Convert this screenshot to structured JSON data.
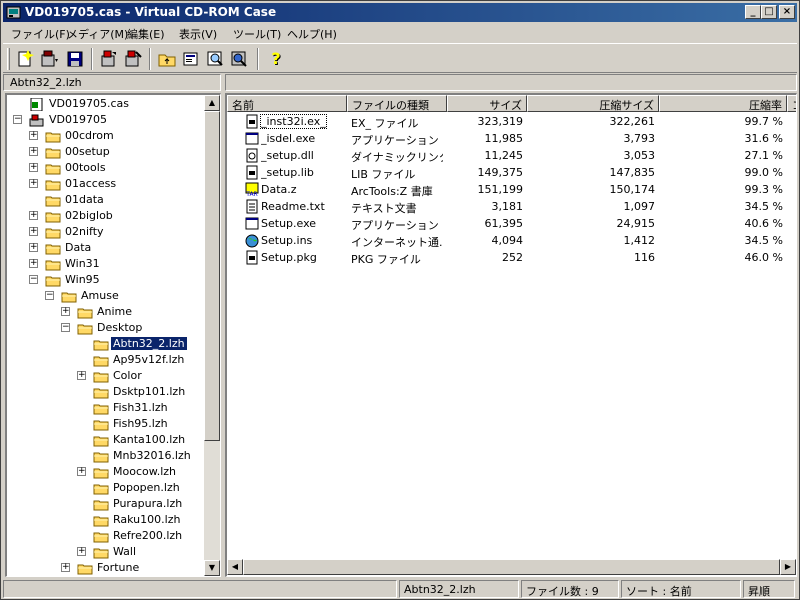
{
  "window": {
    "title": "VD019705.cas - Virtual CD-ROM Case",
    "minimize": "_",
    "maximize": "□",
    "close": "×"
  },
  "menu": [
    {
      "label": "ファイル(F)"
    },
    {
      "label": "メディア(M)"
    },
    {
      "label": "編集(E)"
    },
    {
      "label": "表示(V)"
    },
    {
      "label": "ツール(T)"
    },
    {
      "label": "ヘルプ(H)"
    }
  ],
  "toolbar": {
    "icons": [
      "new-icon",
      "open-icon",
      "save-icon",
      "mount-icon",
      "unmount-icon",
      "folder-up-icon",
      "properties-icon",
      "search-icon",
      "find-icon",
      "help-icon"
    ]
  },
  "path": {
    "current": "Abtn32_2.lzh"
  },
  "tree": {
    "items": [
      {
        "label": "VD019705.cas",
        "exp": "",
        "depth": 0,
        "icon": "cas-file-icon"
      },
      {
        "label": "VD019705",
        "exp": "−",
        "depth": 0,
        "icon": "cdrom-icon"
      },
      {
        "label": "00cdrom",
        "exp": "+",
        "depth": 1
      },
      {
        "label": "00setup",
        "exp": "+",
        "depth": 1
      },
      {
        "label": "00tools",
        "exp": "+",
        "depth": 1
      },
      {
        "label": "01access",
        "exp": "+",
        "depth": 1
      },
      {
        "label": "01data",
        "exp": "",
        "depth": 1
      },
      {
        "label": "02biglob",
        "exp": "+",
        "depth": 1
      },
      {
        "label": "02nifty",
        "exp": "+",
        "depth": 1
      },
      {
        "label": "Data",
        "exp": "+",
        "depth": 1
      },
      {
        "label": "Win31",
        "exp": "+",
        "depth": 1
      },
      {
        "label": "Win95",
        "exp": "−",
        "depth": 1
      },
      {
        "label": "Amuse",
        "exp": "−",
        "depth": 2
      },
      {
        "label": "Anime",
        "exp": "+",
        "depth": 3
      },
      {
        "label": "Desktop",
        "exp": "−",
        "depth": 3
      },
      {
        "label": "Abtn32_2.lzh",
        "exp": "",
        "depth": 4,
        "selected": true
      },
      {
        "label": "Ap95v12f.lzh",
        "exp": "",
        "depth": 4
      },
      {
        "label": "Color",
        "exp": "+",
        "depth": 4
      },
      {
        "label": "Dsktp101.lzh",
        "exp": "",
        "depth": 4
      },
      {
        "label": "Fish31.lzh",
        "exp": "",
        "depth": 4
      },
      {
        "label": "Fish95.lzh",
        "exp": "",
        "depth": 4
      },
      {
        "label": "Kanta100.lzh",
        "exp": "",
        "depth": 4
      },
      {
        "label": "Mnb32016.lzh",
        "exp": "",
        "depth": 4
      },
      {
        "label": "Moocow.lzh",
        "exp": "+",
        "depth": 4
      },
      {
        "label": "Popopen.lzh",
        "exp": "",
        "depth": 4
      },
      {
        "label": "Purapura.lzh",
        "exp": "",
        "depth": 4
      },
      {
        "label": "Raku100.lzh",
        "exp": "",
        "depth": 4
      },
      {
        "label": "Refre200.lzh",
        "exp": "",
        "depth": 4
      },
      {
        "label": "Wall",
        "exp": "+",
        "depth": 4
      },
      {
        "label": "Fortune",
        "exp": "+",
        "depth": 3
      }
    ]
  },
  "list": {
    "columns": [
      {
        "label": "名前"
      },
      {
        "label": "ファイルの種類"
      },
      {
        "label": "サイズ"
      },
      {
        "label": "圧縮サイズ"
      },
      {
        "label": "圧縮率"
      },
      {
        "label": "コ"
      }
    ],
    "rows": [
      {
        "name": "_inst32i.ex_",
        "type": "EX_ ファイル",
        "size": "323,319",
        "packed": "322,261",
        "ratio": "99.7 %",
        "icon": "generic-file-icon"
      },
      {
        "name": "_isdel.exe",
        "type": "アプリケーション",
        "size": "11,985",
        "packed": "3,793",
        "ratio": "31.6 %",
        "icon": "exe-file-icon"
      },
      {
        "name": "_setup.dll",
        "type": "ダイナミックリンク...",
        "size": "11,245",
        "packed": "3,053",
        "ratio": "27.1 %",
        "icon": "dll-file-icon"
      },
      {
        "name": "_setup.lib",
        "type": "LIB ファイル",
        "size": "149,375",
        "packed": "147,835",
        "ratio": "99.0 %",
        "icon": "generic-file-icon"
      },
      {
        "name": "Data.z",
        "type": "ArcTools:Z 書庫",
        "size": "151,199",
        "packed": "150,174",
        "ratio": "99.3 %",
        "icon": "archive-file-icon"
      },
      {
        "name": "Readme.txt",
        "type": "テキスト文書",
        "size": "3,181",
        "packed": "1,097",
        "ratio": "34.5 %",
        "icon": "text-file-icon"
      },
      {
        "name": "Setup.exe",
        "type": "アプリケーション",
        "size": "61,395",
        "packed": "24,915",
        "ratio": "40.6 %",
        "icon": "exe-file-icon"
      },
      {
        "name": "Setup.ins",
        "type": "インターネット通...",
        "size": "4,094",
        "packed": "1,412",
        "ratio": "34.5 %",
        "icon": "internet-file-icon"
      },
      {
        "name": "Setup.pkg",
        "type": "PKG ファイル",
        "size": "252",
        "packed": "116",
        "ratio": "46.0 %",
        "icon": "generic-file-icon"
      }
    ]
  },
  "status": {
    "file": "Abtn32_2.lzh",
    "count": "ファイル数 : 9",
    "sort": "ソート : 名前",
    "order": "昇順"
  }
}
